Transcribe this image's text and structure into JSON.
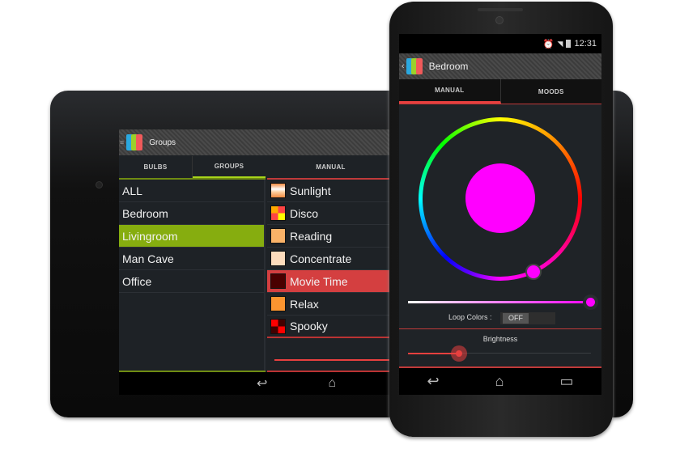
{
  "tablet": {
    "title": "Groups",
    "tabs": [
      {
        "label": "BULBS"
      },
      {
        "label": "GROUPS",
        "active": true
      }
    ],
    "groups": [
      "ALL",
      "Bedroom",
      "Livingroom",
      "Man Cave",
      "Office"
    ],
    "selected_group": "Livingroom",
    "manual_tab": "MANUAL",
    "moods": [
      {
        "label": "Sunlight"
      },
      {
        "label": "Disco"
      },
      {
        "label": "Reading"
      },
      {
        "label": "Concentrate"
      },
      {
        "label": "Movie Time",
        "selected": true
      },
      {
        "label": "Relax"
      },
      {
        "label": "Spooky"
      }
    ],
    "nav": {
      "back": "↩",
      "home": "⌂"
    }
  },
  "phone": {
    "status": {
      "time": "12:31",
      "icons": [
        "alarm-icon",
        "wifi-icon",
        "signal-icon",
        "battery-icon"
      ]
    },
    "title": "Bedroom",
    "tabs": [
      {
        "label": "MANUAL",
        "active": true
      },
      {
        "label": "MOODS"
      }
    ],
    "selected_color": "#ff00ff",
    "saturation": 1.0,
    "loop_colors_label": "Loop Colors :",
    "loop_colors_value": "OFF",
    "brightness_label": "Brightness",
    "brightness": 0.28,
    "nav": {
      "back": "↩",
      "home": "⌂",
      "recents": "▭"
    }
  },
  "colors": {
    "accent_red": "#e8403f",
    "accent_green": "#86ad0f",
    "magenta": "#ff00ff"
  }
}
